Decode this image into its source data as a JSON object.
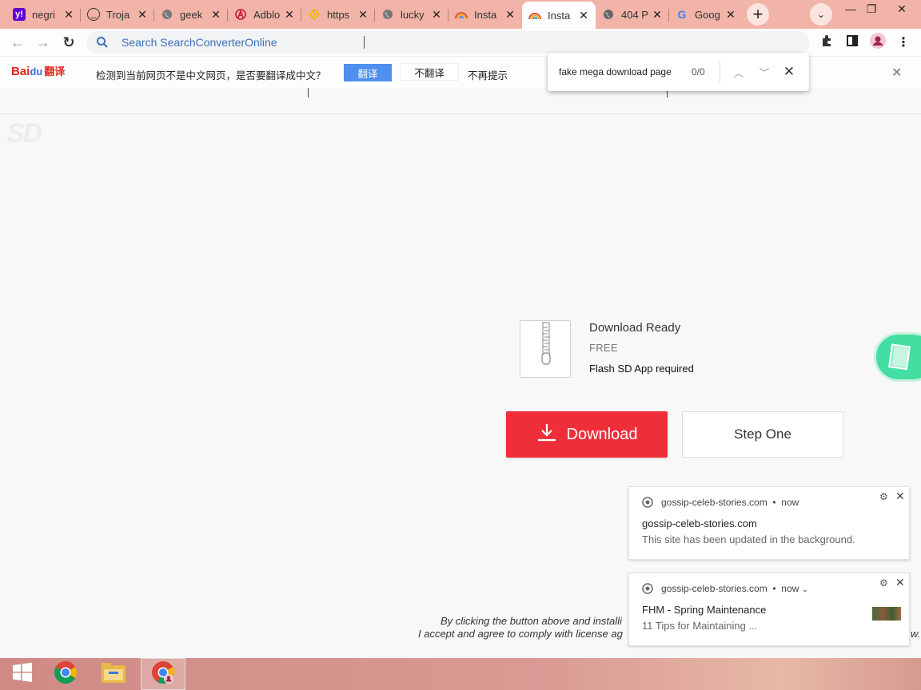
{
  "tabs": [
    {
      "title": "negri",
      "favicon": "yahoo-icon",
      "color": "#6001d2",
      "active": false
    },
    {
      "title": "Troja",
      "favicon": "smiley-icon",
      "color": "#333333",
      "active": false
    },
    {
      "title": "geek",
      "favicon": "globe-icon",
      "color": "#666666",
      "active": false
    },
    {
      "title": "Adblo",
      "favicon": "adblock-icon",
      "color": "#c8102e",
      "active": false
    },
    {
      "title": "https",
      "favicon": "binance-icon",
      "color": "#f0b90b",
      "active": false
    },
    {
      "title": "lucky",
      "favicon": "globe-icon",
      "color": "#666666",
      "active": false
    },
    {
      "title": "Insta",
      "favicon": "rainbow-icon",
      "color": "#e96a3a",
      "active": false
    },
    {
      "title": "Insta",
      "favicon": "rainbow-icon",
      "color": "#e96a3a",
      "active": true
    },
    {
      "title": "404 P",
      "favicon": "globe-icon",
      "color": "#666666",
      "active": false
    },
    {
      "title": "Goog",
      "favicon": "google-icon",
      "color": "#4285f4",
      "active": false
    }
  ],
  "toolbar": {
    "omnibox_text": "Search SearchConverterOnline"
  },
  "translate_bar": {
    "brand": "Bai",
    "brand_paw": "du",
    "brand_cn": "翻译",
    "message": "检测到当前网页不是中文网页，是否要翻译成中文？",
    "translate_label": "翻译",
    "no_translate_label": "不翻译",
    "no_remind_label": "不再提示"
  },
  "find_bar": {
    "query": "fake mega download page",
    "count": "0/0"
  },
  "page": {
    "download_ready": "Download Ready",
    "price": "FREE",
    "requirement": "Flash SD App required",
    "download_label": "Download",
    "step_label": "Step One",
    "disclaimer_line1": "By clicking the button above and installi",
    "disclaimer_line2": "I accept and agree to comply with license ag",
    "disclaimer_tail": "w."
  },
  "notifications": [
    {
      "source": "gossip-celeb-stories.com",
      "time": "now",
      "title": "gossip-celeb-stories.com",
      "body": "This site has been updated in the background."
    },
    {
      "source": "gossip-celeb-stories.com",
      "time": "now",
      "title": "FHM - Spring Maintenance",
      "body": "11 Tips for Maintaining ..."
    }
  ],
  "colors": {
    "download_red": "#ee2f3a",
    "tabstrip": "#f2b3a8",
    "translate_blue": "#4e8ff0"
  }
}
